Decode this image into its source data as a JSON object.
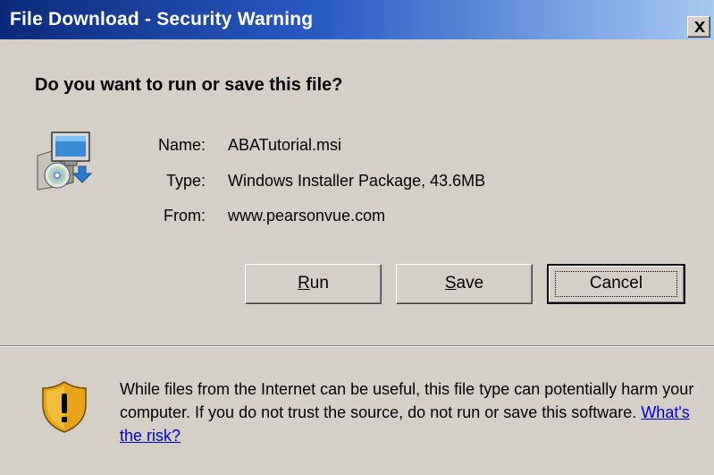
{
  "window": {
    "title": "File Download - Security Warning",
    "close_label": "X"
  },
  "question": "Do you want to run or save this file?",
  "file_info": [
    {
      "label": "Name:",
      "value": "ABATutorial.msi"
    },
    {
      "label": "Type:",
      "value": "Windows Installer Package, 43.6MB"
    },
    {
      "label": "From:",
      "value": "www.pearsonvue.com"
    }
  ],
  "buttons": {
    "run": {
      "label": "Run",
      "mnemonic": "R",
      "rest": "un"
    },
    "save": {
      "label": "Save",
      "mnemonic": "S",
      "rest": "ave"
    },
    "cancel": {
      "label": "Cancel"
    }
  },
  "warning": {
    "text": "While files from the Internet can be useful, this file type can potentially harm your computer. If you do not trust the source, do not run or save this software. ",
    "link": "What's the risk?"
  },
  "icons": {
    "file": "installer-package-icon",
    "warning": "security-shield-warning-icon",
    "close": "close-icon"
  },
  "colors": {
    "titlebar_start": "#0b2a7a",
    "titlebar_end": "#a6caf0",
    "dialog_background": "#d4d0c8",
    "link": "#0000cc",
    "shield_gold": "#e8a316"
  }
}
